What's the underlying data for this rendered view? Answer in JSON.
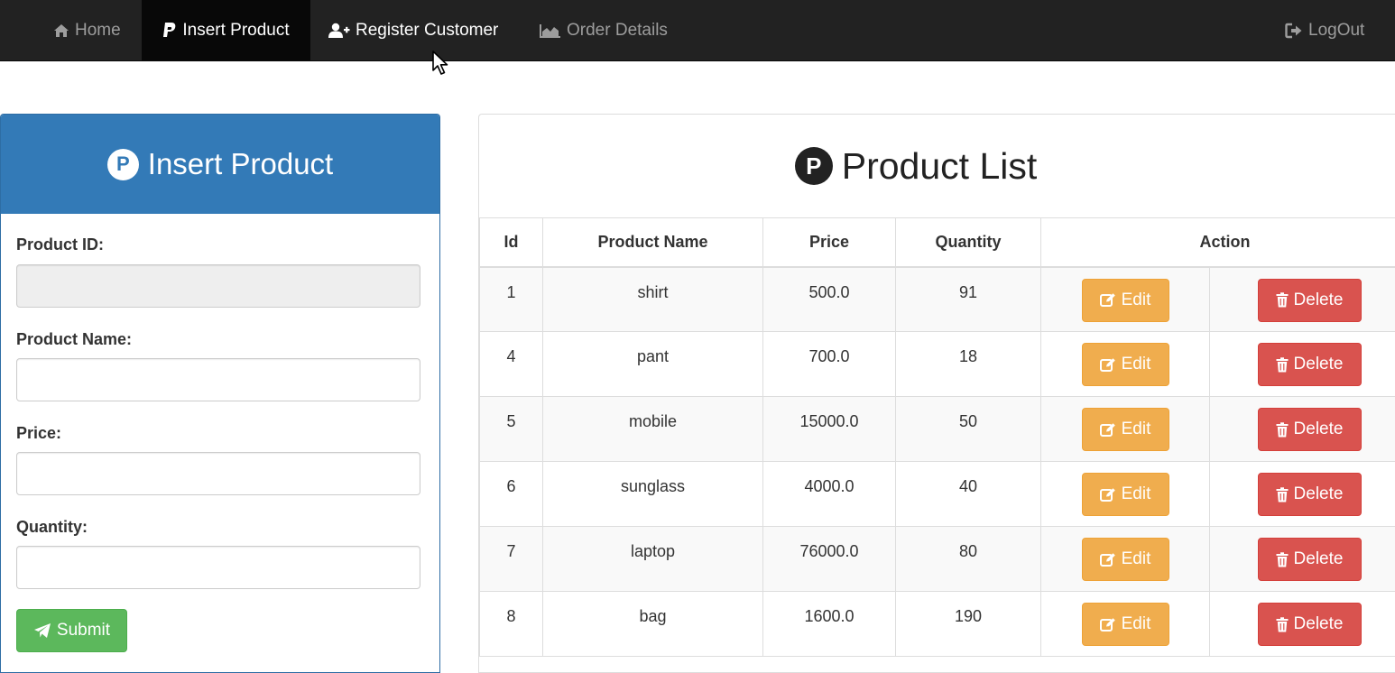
{
  "navbar": {
    "home": "Home",
    "insert_product": "Insert Product",
    "register_customer": "Register Customer",
    "order_details": "Order Details",
    "logout": "LogOut",
    "colors": {
      "background": "#222222",
      "active": "#080808",
      "muted_text": "#9d9d9d"
    }
  },
  "insert_form": {
    "title": "Insert Product",
    "badge": "P",
    "fields": [
      {
        "label": "Product ID:",
        "value": "",
        "readonly": true
      },
      {
        "label": "Product Name:",
        "value": ""
      },
      {
        "label": "Price:",
        "value": ""
      },
      {
        "label": "Quantity:",
        "value": ""
      }
    ],
    "submit": "Submit",
    "colors": {
      "header": "#337ab7",
      "submit": "#5cb85c"
    }
  },
  "product_list": {
    "title": "Product List",
    "badge": "P",
    "columns": [
      "Id",
      "Product Name",
      "Price",
      "Quantity",
      "Action"
    ],
    "edit_label": "Edit",
    "delete_label": "Delete",
    "rows": [
      {
        "id": "1",
        "name": "shirt",
        "price": "500.0",
        "quantity": "91"
      },
      {
        "id": "4",
        "name": "pant",
        "price": "700.0",
        "quantity": "18"
      },
      {
        "id": "5",
        "name": "mobile",
        "price": "15000.0",
        "quantity": "50"
      },
      {
        "id": "6",
        "name": "sunglass",
        "price": "4000.0",
        "quantity": "40"
      },
      {
        "id": "7",
        "name": "laptop",
        "price": "76000.0",
        "quantity": "80"
      },
      {
        "id": "8",
        "name": "bag",
        "price": "1600.0",
        "quantity": "190"
      }
    ],
    "colors": {
      "edit": "#f0ad4e",
      "delete": "#d9534f"
    }
  }
}
